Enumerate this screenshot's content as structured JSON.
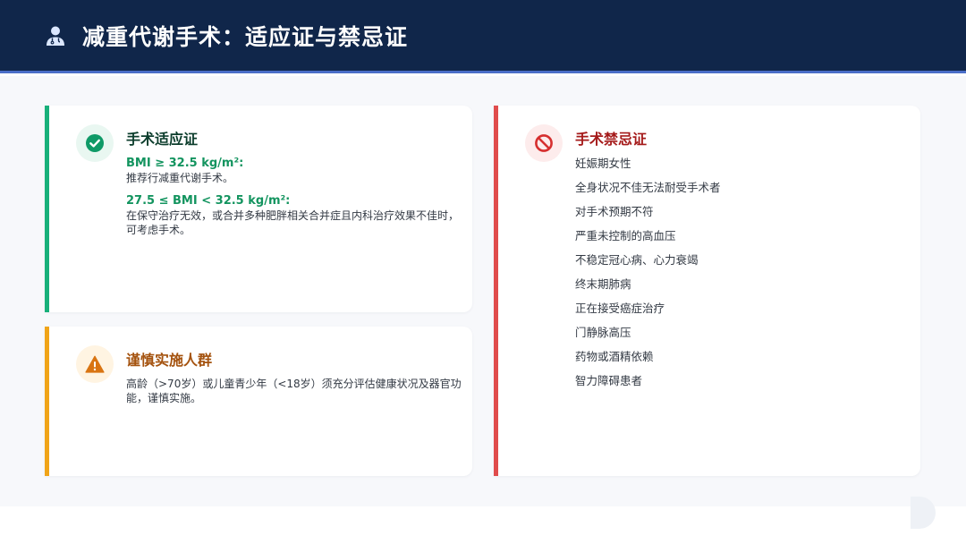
{
  "header": {
    "title": "减重代谢手术：适应证与禁忌证",
    "icon": "doctor-icon"
  },
  "indications": {
    "icon": "check-circle-icon",
    "title": "手术适应证",
    "items": [
      {
        "head": "BMI ≥ 32.5 kg/m²:",
        "text": "推荐行减重代谢手术。"
      },
      {
        "head": "27.5 ≤ BMI < 32.5 kg/m²:",
        "text": "在保守治疗无效，或合并多种肥胖相关合并症且内科治疗效果不佳时，可考虑手术。"
      }
    ]
  },
  "caution": {
    "icon": "warning-icon",
    "title": "谨慎实施人群",
    "text": "高龄（>70岁）或儿童青少年（<18岁）须充分评估健康状况及器官功能，谨慎实施。"
  },
  "contraindications": {
    "icon": "prohibited-icon",
    "title": "手术禁忌证",
    "items": [
      "妊娠期女性",
      "全身状况不佳无法耐受手术者",
      "对手术预期不符",
      "严重未控制的高血压",
      "不稳定冠心病、心力衰竭",
      "终末期肺病",
      "正在接受癌症治疗",
      "门静脉高压",
      "药物或酒精依赖",
      "智力障碍患者"
    ]
  },
  "colors": {
    "header_bg": "#10264a",
    "accent_green": "#18b07a",
    "accent_orange": "#f0a418",
    "accent_red": "#e04c4c"
  }
}
